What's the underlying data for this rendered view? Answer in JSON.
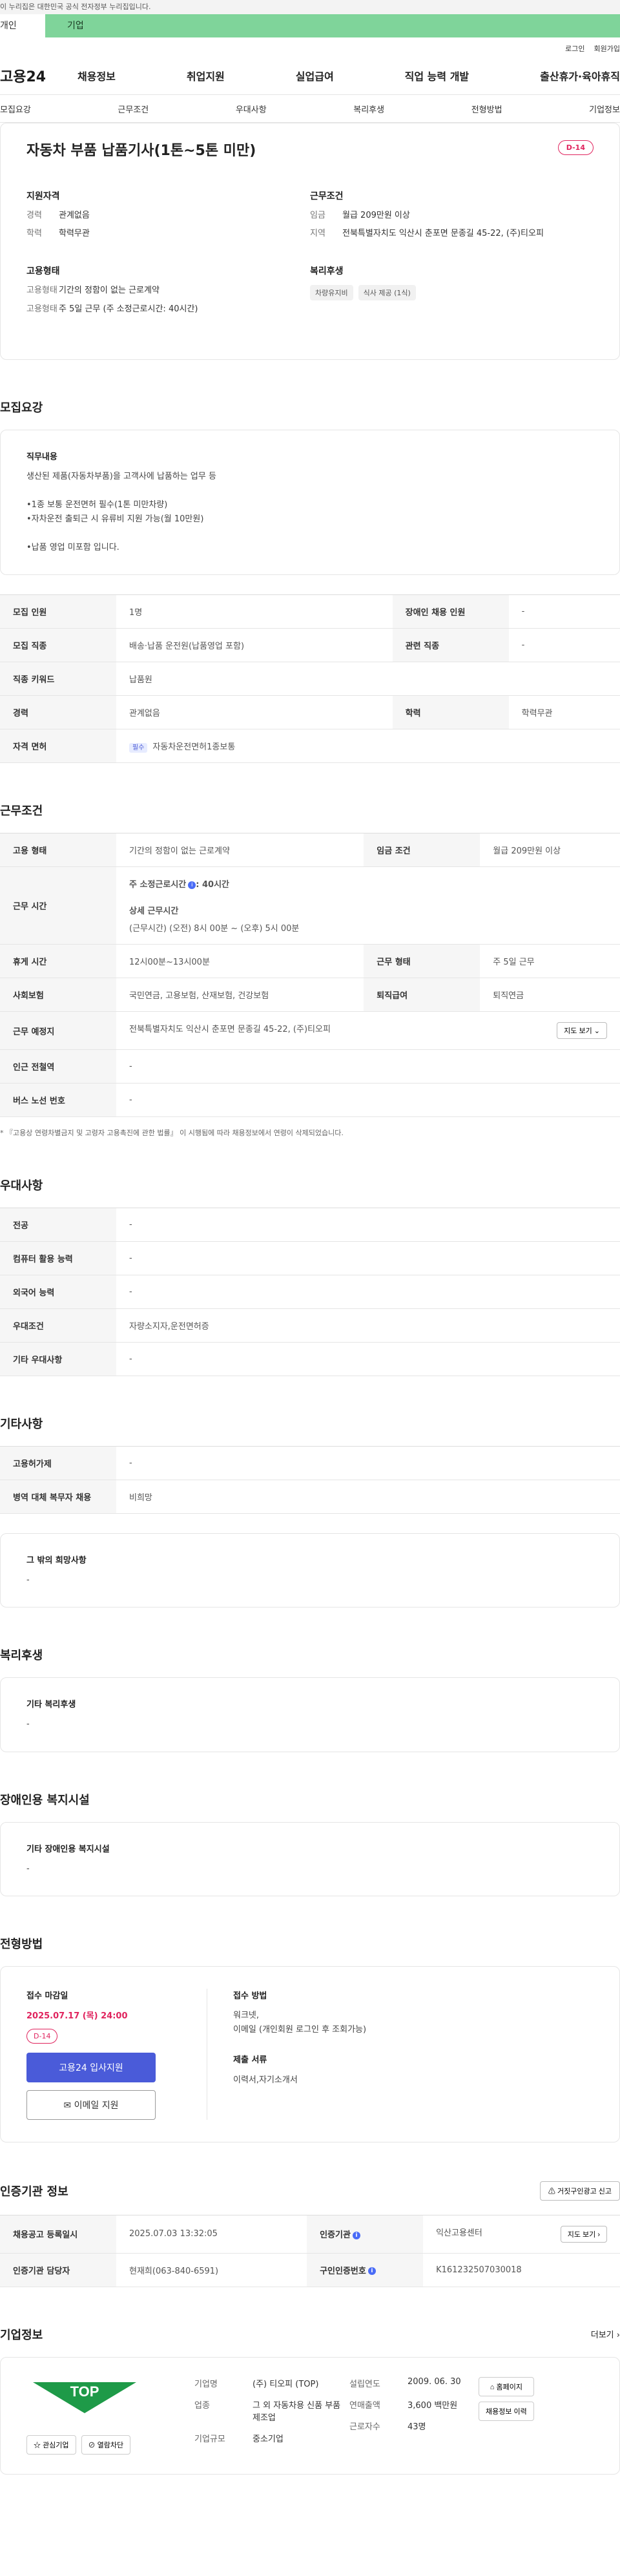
{
  "gov_strip": "이 누리집은 대한민국 공식 전자정부 누리집입니다.",
  "tabs": {
    "personal": "개인",
    "corporate": "기업"
  },
  "util": {
    "login": "로그인",
    "signup": "회원가입"
  },
  "gnb": {
    "logo": "고용24",
    "menu": [
      "채용정보",
      "취업지원",
      "실업급여",
      "직업 능력 개발",
      "출산휴가·육아휴직"
    ]
  },
  "anchor_nav": [
    "모집요강",
    "근무조건",
    "우대사항",
    "복리후생",
    "전형방법",
    "기업정보"
  ],
  "summary": {
    "title": "자동차 부품 납품기사(1톤~5톤 미만)",
    "dday": "D-14",
    "qualifications": {
      "heading": "지원자격",
      "career_k": "경력",
      "career_v": "관계없음",
      "edu_k": "학력",
      "edu_v": "학력무관"
    },
    "employment": {
      "heading": "고용형태",
      "type_k": "고용형태",
      "type_v": "기간의 정함이 없는 근로계약",
      "hours_v": "주 5일 근무 (주 소정근로시간: 40시간)"
    },
    "conditions": {
      "heading": "근무조건",
      "wage_k": "임금",
      "wage_v": "월급 209만원 이상",
      "area_k": "지역",
      "area_v": "전북특별자치도 익산시 춘포면 문종길 45-22, (주)티오피"
    },
    "welfare": {
      "heading": "복리후생",
      "chips": [
        "차량유지비",
        "식사 제공 (1식)"
      ]
    }
  },
  "recruit": {
    "section_title": "모집요강",
    "duty_heading": "직무내용",
    "duty_text": "생산된 제품(자동차부품)을 고객사에 납품하는 업무 등\n\n•1종 보통 운전면허 필수(1톤 미만차량)\n•자차운전 출퇴근 시 유류비 지원 가능(월 10만원)\n\n•납품 영업 미포함 입니다.",
    "table": {
      "headcount_k": "모집 인원",
      "headcount_v": "1명",
      "disabled_k": "장애인 채용 인원",
      "disabled_v": "-",
      "job_k": "모집 직종",
      "job_v": "배송·납품 운전원(납품영업 포함)",
      "related_k": "관련 직종",
      "related_v": "-",
      "keyword_k": "직종 키워드",
      "keyword_v": "납품원",
      "career_k": "경력",
      "career_v": "관계없음",
      "edu_k": "학력",
      "edu_v": "학력무관",
      "license_k": "자격 면허",
      "license_badge": "필수",
      "license_v": "자동차운전면허1종보통"
    }
  },
  "work": {
    "section_title": "근무조건",
    "type_k": "고용 형태",
    "type_v": "기간의 정함이 없는 근로계약",
    "wage_k": "임금 조건",
    "wage_v": "월급 209만원 이상",
    "hours_k": "근무 시간",
    "hours_weekly": "주 소정근로시간",
    "hours_weekly_v": ": 40시간",
    "hours_detail_h": "상세 근무시간",
    "hours_detail_v": "(근무시간) (오전) 8시 00분 ~ (오후) 5시 00분",
    "rest_k": "휴게 시간",
    "rest_v": "12시00분~13시00분",
    "form_k": "근무 형태",
    "form_v": "주 5일 근무",
    "insurance_k": "사회보험",
    "insurance_v": "국민연금, 고용보험, 산재보험, 건강보험",
    "pension_k": "퇴직급여",
    "pension_v": "퇴직연금",
    "place_k": "근무 예정지",
    "place_v": "전북특별자치도 익산시 춘포면 문종길 45-22, (주)티오피",
    "map_btn": "지도 보기",
    "subway_k": "인근 전철역",
    "subway_v": "-",
    "bus_k": "버스 노선 번호",
    "bus_v": "-",
    "note": "* 『고용상 연령차별금지 및 고령자 고용촉진에 관한 법률』 이 시행됨에 따라 채용정보에서 연령이 삭제되었습니다."
  },
  "prefer": {
    "section_title": "우대사항",
    "major_k": "전공",
    "major_v": "-",
    "computer_k": "컴퓨터 활용 능력",
    "computer_v": "-",
    "lang_k": "외국어 능력",
    "lang_v": "-",
    "cond_k": "우대조건",
    "cond_v": "자량소지자,운전면허증",
    "etc_k": "기타 우대사항",
    "etc_v": "-"
  },
  "other": {
    "section_title": "기타사항",
    "permit_k": "고용허가제",
    "permit_v": "-",
    "military_k": "병역 대체 복무자 채용",
    "military_v": "비희망",
    "wish_h": "그 밖의 희망사항",
    "wish_v": "-"
  },
  "welfare": {
    "section_title": "복리후생",
    "h": "기타 복리후생",
    "v": "-"
  },
  "facility": {
    "section_title": "장애인용 복지시설",
    "h": "기타 장애인용 복지시설",
    "v": "-"
  },
  "process": {
    "section_title": "전형방법",
    "deadline_h": "접수 마감일",
    "deadline_v": "2025.07.17 (목) 24:00",
    "dday": "D-14",
    "apply_btn": "고용24 입사지원",
    "email_btn": "이메일 지원",
    "method_h": "접수 방법",
    "method_v": "워크넷,\n이메일 (개인회원 로그인 후 조회가능)",
    "docs_h": "제출 서류",
    "docs_v": "이력서,자기소개서"
  },
  "cert": {
    "section_title": "인증기관 정보",
    "report_btn": "거짓구인광고 신고",
    "reg_k": "채용공고 등록일시",
    "reg_v": "2025.07.03 13:32:05",
    "org_k": "인증기관",
    "org_v": "익산고용센터",
    "map_btn": "지도 보기",
    "mgr_k": "인증기관 담당자",
    "mgr_v": "현재희(063-840-6591)",
    "num_k": "구인인증번호",
    "num_v": "K161232507030018"
  },
  "company": {
    "section_title": "기업정보",
    "more": "더보기",
    "logo_text": "TOP",
    "fav_btn": "관심기업",
    "block_btn": "열람차단",
    "name_k": "기업명",
    "name_v": "(주) 티오피 (TOP)",
    "biz_k": "업종",
    "biz_v": "그 외 자동차용 신품 부품 제조업",
    "size_k": "기업규모",
    "size_v": "중소기업",
    "est_k": "설립연도",
    "est_v": "2009. 06. 30",
    "sales_k": "연매출액",
    "sales_v": "3,600 백만원",
    "emp_k": "근로자수",
    "emp_v": "43명",
    "home_btn": "홈페이지",
    "list_btn": "채용정보 이력"
  },
  "colors": {
    "accent": "#4a5bd9",
    "dday": "#e0245e",
    "tab_green": "#7fd49a"
  }
}
